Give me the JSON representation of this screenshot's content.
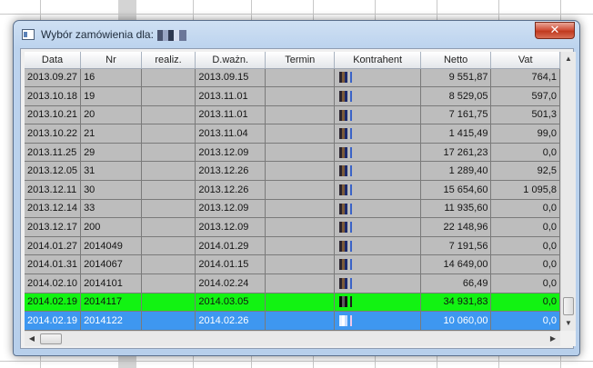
{
  "window": {
    "title": "Wybór zamówienia dla:",
    "close_glyph": "✕"
  },
  "grid": {
    "columns": [
      "Data",
      "Nr",
      "realiz.",
      "D.ważn.",
      "Termin",
      "Kontrahent",
      "Netto",
      "Vat"
    ],
    "rows": [
      {
        "data": "2013.09.27",
        "nr": "16",
        "realiz": "",
        "dwazn": "2013.09.15",
        "termin": "",
        "netto": "9 551,87",
        "vat": "764,1",
        "state": "normal"
      },
      {
        "data": "2013.10.18",
        "nr": "19",
        "realiz": "",
        "dwazn": "2013.11.01",
        "termin": "",
        "netto": "8 529,05",
        "vat": "597,0",
        "state": "normal"
      },
      {
        "data": "2013.10.21",
        "nr": "20",
        "realiz": "",
        "dwazn": "2013.11.01",
        "termin": "",
        "netto": "7 161,75",
        "vat": "501,3",
        "state": "normal"
      },
      {
        "data": "2013.10.22",
        "nr": "21",
        "realiz": "",
        "dwazn": "2013.11.04",
        "termin": "",
        "netto": "1 415,49",
        "vat": "99,0",
        "state": "normal"
      },
      {
        "data": "2013.11.25",
        "nr": "29",
        "realiz": "",
        "dwazn": "2013.12.09",
        "termin": "",
        "netto": "17 261,23",
        "vat": "0,0",
        "state": "normal"
      },
      {
        "data": "2013.12.05",
        "nr": "31",
        "realiz": "",
        "dwazn": "2013.12.26",
        "termin": "",
        "netto": "1 289,40",
        "vat": "92,5",
        "state": "normal"
      },
      {
        "data": "2013.12.11",
        "nr": "30",
        "realiz": "",
        "dwazn": "2013.12.26",
        "termin": "",
        "netto": "15 654,60",
        "vat": "1 095,8",
        "state": "normal"
      },
      {
        "data": "2013.12.14",
        "nr": "33",
        "realiz": "",
        "dwazn": "2013.12.09",
        "termin": "",
        "netto": "11 935,60",
        "vat": "0,0",
        "state": "normal"
      },
      {
        "data": "2013.12.17",
        "nr": "200",
        "realiz": "",
        "dwazn": "2013.12.09",
        "termin": "",
        "netto": "22 148,96",
        "vat": "0,0",
        "state": "normal"
      },
      {
        "data": "2014.01.27",
        "nr": "2014049",
        "realiz": "",
        "dwazn": "2014.01.29",
        "termin": "",
        "netto": "7 191,56",
        "vat": "0,0",
        "state": "normal"
      },
      {
        "data": "2014.01.31",
        "nr": "2014067",
        "realiz": "",
        "dwazn": "2014.01.15",
        "termin": "",
        "netto": "14 649,00",
        "vat": "0,0",
        "state": "normal"
      },
      {
        "data": "2014.02.10",
        "nr": "2014101",
        "realiz": "",
        "dwazn": "2014.02.24",
        "termin": "",
        "netto": "66,49",
        "vat": "0,0",
        "state": "normal"
      },
      {
        "data": "2014.02.19",
        "nr": "2014117",
        "realiz": "",
        "dwazn": "2014.03.05",
        "termin": "",
        "netto": "34 931,83",
        "vat": "0,0",
        "state": "highlight"
      },
      {
        "data": "2014.02.19",
        "nr": "2014122",
        "realiz": "",
        "dwazn": "2014.02.26",
        "termin": "",
        "netto": "10 060,00",
        "vat": "0,0",
        "state": "selected"
      }
    ]
  },
  "colors": {
    "row_default": "#bdbdbd",
    "row_highlight": "#12f312",
    "row_selected": "#3e97f0"
  },
  "scrollbars": {
    "up_glyph": "▲",
    "down_glyph": "▼",
    "left_glyph": "◀",
    "right_glyph": "▶"
  }
}
